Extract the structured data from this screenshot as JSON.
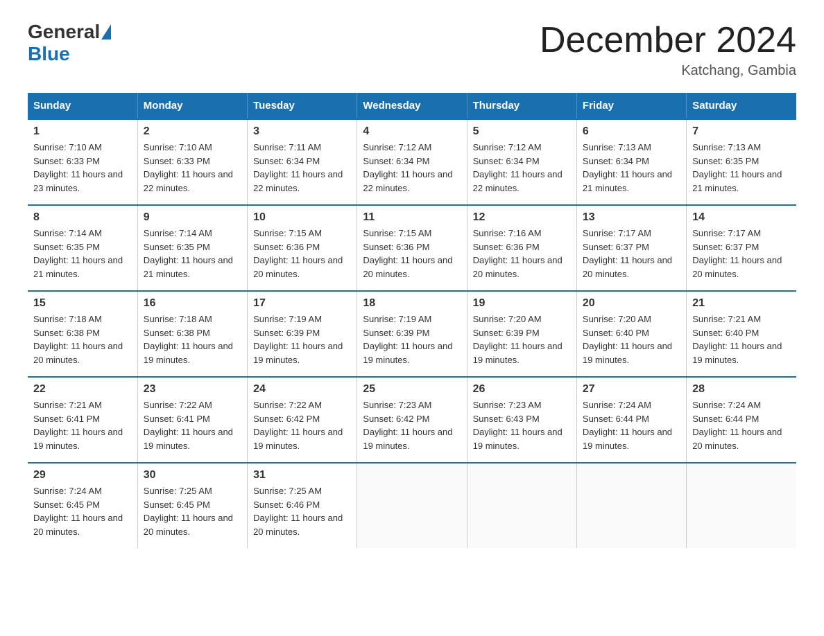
{
  "header": {
    "logo": {
      "general": "General",
      "blue": "Blue"
    },
    "title": "December 2024",
    "location": "Katchang, Gambia"
  },
  "days_of_week": [
    "Sunday",
    "Monday",
    "Tuesday",
    "Wednesday",
    "Thursday",
    "Friday",
    "Saturday"
  ],
  "weeks": [
    [
      {
        "day": "1",
        "sunrise": "7:10 AM",
        "sunset": "6:33 PM",
        "daylight": "11 hours and 23 minutes."
      },
      {
        "day": "2",
        "sunrise": "7:10 AM",
        "sunset": "6:33 PM",
        "daylight": "11 hours and 22 minutes."
      },
      {
        "day": "3",
        "sunrise": "7:11 AM",
        "sunset": "6:34 PM",
        "daylight": "11 hours and 22 minutes."
      },
      {
        "day": "4",
        "sunrise": "7:12 AM",
        "sunset": "6:34 PM",
        "daylight": "11 hours and 22 minutes."
      },
      {
        "day": "5",
        "sunrise": "7:12 AM",
        "sunset": "6:34 PM",
        "daylight": "11 hours and 22 minutes."
      },
      {
        "day": "6",
        "sunrise": "7:13 AM",
        "sunset": "6:34 PM",
        "daylight": "11 hours and 21 minutes."
      },
      {
        "day": "7",
        "sunrise": "7:13 AM",
        "sunset": "6:35 PM",
        "daylight": "11 hours and 21 minutes."
      }
    ],
    [
      {
        "day": "8",
        "sunrise": "7:14 AM",
        "sunset": "6:35 PM",
        "daylight": "11 hours and 21 minutes."
      },
      {
        "day": "9",
        "sunrise": "7:14 AM",
        "sunset": "6:35 PM",
        "daylight": "11 hours and 21 minutes."
      },
      {
        "day": "10",
        "sunrise": "7:15 AM",
        "sunset": "6:36 PM",
        "daylight": "11 hours and 20 minutes."
      },
      {
        "day": "11",
        "sunrise": "7:15 AM",
        "sunset": "6:36 PM",
        "daylight": "11 hours and 20 minutes."
      },
      {
        "day": "12",
        "sunrise": "7:16 AM",
        "sunset": "6:36 PM",
        "daylight": "11 hours and 20 minutes."
      },
      {
        "day": "13",
        "sunrise": "7:17 AM",
        "sunset": "6:37 PM",
        "daylight": "11 hours and 20 minutes."
      },
      {
        "day": "14",
        "sunrise": "7:17 AM",
        "sunset": "6:37 PM",
        "daylight": "11 hours and 20 minutes."
      }
    ],
    [
      {
        "day": "15",
        "sunrise": "7:18 AM",
        "sunset": "6:38 PM",
        "daylight": "11 hours and 20 minutes."
      },
      {
        "day": "16",
        "sunrise": "7:18 AM",
        "sunset": "6:38 PM",
        "daylight": "11 hours and 19 minutes."
      },
      {
        "day": "17",
        "sunrise": "7:19 AM",
        "sunset": "6:39 PM",
        "daylight": "11 hours and 19 minutes."
      },
      {
        "day": "18",
        "sunrise": "7:19 AM",
        "sunset": "6:39 PM",
        "daylight": "11 hours and 19 minutes."
      },
      {
        "day": "19",
        "sunrise": "7:20 AM",
        "sunset": "6:39 PM",
        "daylight": "11 hours and 19 minutes."
      },
      {
        "day": "20",
        "sunrise": "7:20 AM",
        "sunset": "6:40 PM",
        "daylight": "11 hours and 19 minutes."
      },
      {
        "day": "21",
        "sunrise": "7:21 AM",
        "sunset": "6:40 PM",
        "daylight": "11 hours and 19 minutes."
      }
    ],
    [
      {
        "day": "22",
        "sunrise": "7:21 AM",
        "sunset": "6:41 PM",
        "daylight": "11 hours and 19 minutes."
      },
      {
        "day": "23",
        "sunrise": "7:22 AM",
        "sunset": "6:41 PM",
        "daylight": "11 hours and 19 minutes."
      },
      {
        "day": "24",
        "sunrise": "7:22 AM",
        "sunset": "6:42 PM",
        "daylight": "11 hours and 19 minutes."
      },
      {
        "day": "25",
        "sunrise": "7:23 AM",
        "sunset": "6:42 PM",
        "daylight": "11 hours and 19 minutes."
      },
      {
        "day": "26",
        "sunrise": "7:23 AM",
        "sunset": "6:43 PM",
        "daylight": "11 hours and 19 minutes."
      },
      {
        "day": "27",
        "sunrise": "7:24 AM",
        "sunset": "6:44 PM",
        "daylight": "11 hours and 19 minutes."
      },
      {
        "day": "28",
        "sunrise": "7:24 AM",
        "sunset": "6:44 PM",
        "daylight": "11 hours and 20 minutes."
      }
    ],
    [
      {
        "day": "29",
        "sunrise": "7:24 AM",
        "sunset": "6:45 PM",
        "daylight": "11 hours and 20 minutes."
      },
      {
        "day": "30",
        "sunrise": "7:25 AM",
        "sunset": "6:45 PM",
        "daylight": "11 hours and 20 minutes."
      },
      {
        "day": "31",
        "sunrise": "7:25 AM",
        "sunset": "6:46 PM",
        "daylight": "11 hours and 20 minutes."
      },
      null,
      null,
      null,
      null
    ]
  ]
}
